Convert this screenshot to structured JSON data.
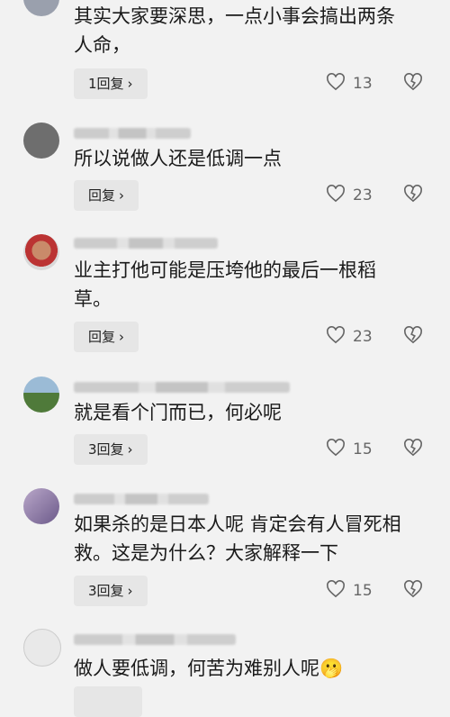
{
  "comments": [
    {
      "text_lines": [
        "其实大家要深思，一点小事会搞出两条",
        "人命，"
      ],
      "reply_label": "1回复",
      "likes": "13"
    },
    {
      "text_lines": [
        "所以说做人还是低调一点"
      ],
      "reply_label": "回复",
      "likes": "23"
    },
    {
      "text_lines": [
        "业主打他可能是压垮他的最后一根稻",
        "草。"
      ],
      "reply_label": "回复",
      "likes": "23"
    },
    {
      "text_lines": [
        "就是看个门而已，何必呢"
      ],
      "reply_label": "3回复",
      "likes": "15"
    },
    {
      "text_lines": [
        "如果杀的是日本人呢 肯定会有人冒死相",
        "救。这是为什么？大家解释一下"
      ],
      "reply_label": "3回复",
      "likes": "15"
    },
    {
      "text_lines": [
        "做人要低调，何苦为难别人呢"
      ],
      "emoji": "🫢"
    }
  ],
  "icons": {
    "like": "heart-outline-icon",
    "dislike": "broken-heart-icon",
    "chevron": "chevron-right-icon"
  },
  "colors": {
    "background": "#f2f2f2",
    "reply_button": "#e6e6e6",
    "icon_gray": "#666666"
  }
}
